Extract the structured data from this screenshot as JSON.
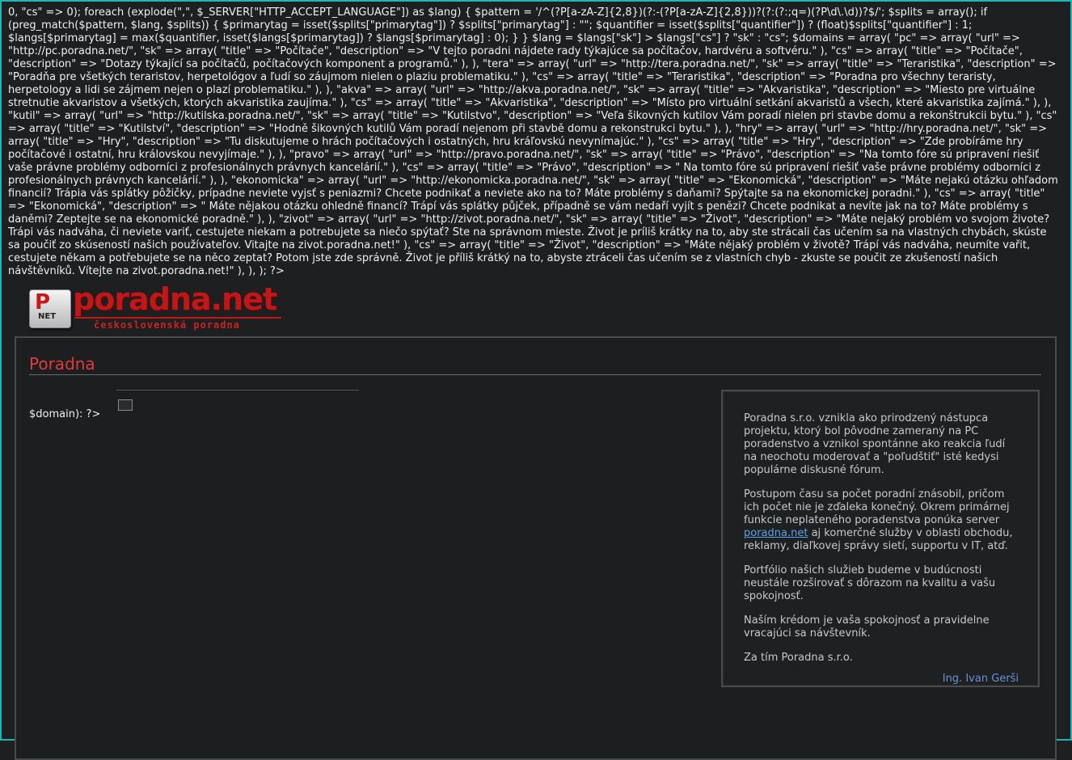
{
  "php_leak": "0, \"cs\" => 0); foreach (explode(\",\", $_SERVER[\"HTTP_ACCEPT_LANGUAGE\"]) as $lang) { $pattern = '/^(?P[a-zA-Z]{2,8})(?:-(?P[a-zA-Z]{2,8}))?(?:(?:;q=)(?P\\d\\.\\d))?$/'; $splits = array(); if (preg_match($pattern, $lang, $splits)) { $primarytag = isset($splits[\"primarytag\"]) ? $splits[\"primarytag\"] : \"\"; $quantifier = isset($splits[\"quantifier\"]) ? (float)$splits[\"quantifier\"] : 1; $langs[$primarytag] = max($quantifier, isset($langs[$primarytag]) ? $langs[$primarytag] : 0); } } $lang = $langs[\"sk\"] > $langs[\"cs\"] ? \"sk\" : \"cs\"; $domains = array( \"pc\" => array( \"url\" => \"http://pc.poradna.net/\", \"sk\" => array( \"title\" => \"Počítače\", \"description\" => \"V tejto poradni nájdete rady týkajúce sa počítačov, hardvéru a softvéru.\" ), \"cs\" => array( \"title\" => \"Počítače\", \"description\" => \"Dotazy týkající sa počítačů, počítačových komponent a programů.\" ), ), \"tera\" => array( \"url\" => \"http://tera.poradna.net/\", \"sk\" => array( \"title\" => \"Teraristika\", \"description\" => \"Poradňa pre všetkých teraristov, herpetológov a ľudí so záujmom nielen o plaziu problematiku.\" ), \"cs\" => array( \"title\" => \"Teraristika\", \"description\" => \"Poradna pro všechny teraristy, herpetology a lidi se zájmem nejen o plazí problematiku.\" ), ), \"akva\" => array( \"url\" => \"http://akva.poradna.net/\", \"sk\" => array( \"title\" => \"Akvaristika\", \"description\" => \"Miesto pre virtuálne stretnutie akvaristov a všetkých, ktorých akvaristika zaujíma.\" ), \"cs\" => array( \"title\" => \"Akvaristika\", \"description\" => \"Místo pro virtuální setkání akvaristů a všech, které akvaristika zajímá.\" ), ), \"kutil\" => array( \"url\" => \"http://kutilska.poradna.net/\", \"sk\" => array( \"title\" => \"Kutilstvo\", \"description\" => \"Veľa šikovných kutilov Vám poradí nielen pri stavbe domu a rekonštrukcii bytu.\" ), \"cs\" => array( \"title\" => \"Kutilství\", \"description\" => \"Hodně šikovných kutilů Vám poradí nejenom při stavbě domu a rekonstrukci bytu.\" ), ), \"hry\" => array( \"url\" => \"http://hry.poradna.net/\", \"sk\" => array( \"title\" => \"Hry\", \"description\" => \"Tu diskutujeme o hrách počítačových i ostatných, hru kráľovskú nevynímajúc.\" ), \"cs\" => array( \"title\" => \"Hry\", \"description\" => \"Zde probíráme hry počítačové i ostatní, hru královskou nevyjímaje.\" ), ), \"pravo\" => array( \"url\" => \"http://pravo.poradna.net/\", \"sk\" => array( \"title\" => \"Právo\", \"description\" => \"Na tomto fóre sú pripravení riešiť vaše právne problémy odborníci z profesionálnych právnych kancelárií.\" ), \"cs\" => array( \"title\" => \"Právo\", \"description\" => \" Na tomto fóre sú pripravení riešiť vaše právne problémy odborníci z profesionálnych právnych kancelárií.\" ), ), \"ekonomicka\" => array( \"url\" => \"http://ekonomicka.poradna.net/\", \"sk\" => array( \"title\" => \"Ekonomická\", \"description\" => \"Máte nejakú otázku ohľadom financií? Trápia vás splátky pôžičky, prípadne neviete vyjsť s peniazmi? Chcete podnikať a neviete ako na to? Máte problémy s daňami? Spýtajte sa na ekonomickej poradni.\" ), \"cs\" => array( \"title\" => \"Ekonomická\", \"description\" => \" Máte nějakou otázku ohledně financí? Trápí vás splátky půjček, případně se vám nedaří vyjít s penězi? Chcete podnikat a nevíte jak na to? Máte problémy s daněmi? Zeptejte se na ekonomické poradně.\" ), ), \"zivot\" => array( \"url\" => \"http://zivot.poradna.net/\", \"sk\" => array( \"title\" => \"Život\", \"description\" => \"Máte nejaký problém vo svojom živote? Trápi vás nadváha, či neviete variť, cestujete niekam a potrebujete sa niečo spýtať? Ste na správnom mieste. Život je príliš krátky na to, aby ste strácali čas učením sa na vlastných chybách, skúste sa poučiť zo skúseností našich používateľov. Vitajte na zivot.poradna.net!\" ), \"cs\" => array( \"title\" => \"Život\", \"description\" => \"Máte nějaký problém v životě? Trápí vás nadváha, neumíte vařit, cestujete někam a potřebujete se na něco zeptat? Potom jste zde správně. Život je příliš krátký na to, abyste ztráceli čas učením se z vlastních chyb - zkuste se poučit ze zkušeností našich návštěvníků. Vítejte na zivot.poradna.net!\" ), ), ); ?>",
  "logo": {
    "badge_letter": "P",
    "badge_text": "NET",
    "wordmark": "poradna.net",
    "tagline": "československá poradna"
  },
  "panel": {
    "title": "Poradna",
    "left_code": "$domain): ?>"
  },
  "info": {
    "p1": "Poradna s.r.o. vznikla ako prirodzený nástupca projektu, ktorý bol pôvodne zameraný na PC poradenstvo a vznikol spontánne ako reakcia ľudí na neochotu moderovať a \"poľudštiť\" isté kedysi populárne diskusné fórum.",
    "p2_before": "Postupom času sa počet poradní znásobil, pričom ich počet nie je zďaleka konečný. Okrem primárnej funkcie neplateného poradenstva ponúka server ",
    "p2_link": "poradna.net",
    "p2_after": " aj komerčné služby v oblasti obchodu, reklamy, diaľkovej správy sietí, supportu v IT, atď.",
    "p3": "Portfólio našich služieb budeme v budúcnosti neustále rozširovať s dôrazom na kvalitu a vašu spokojnosť.",
    "p4": "Naším krédom je vaša spokojnosť a pravidelne vracajúci sa návštevník.",
    "p5": "Za tím Poradna s.r.o.",
    "signature": "Ing. Ivan Gerši"
  },
  "colors": {
    "accent": "#e23b3b",
    "link": "#5aa0e6",
    "frame": "#1fb5b5"
  }
}
